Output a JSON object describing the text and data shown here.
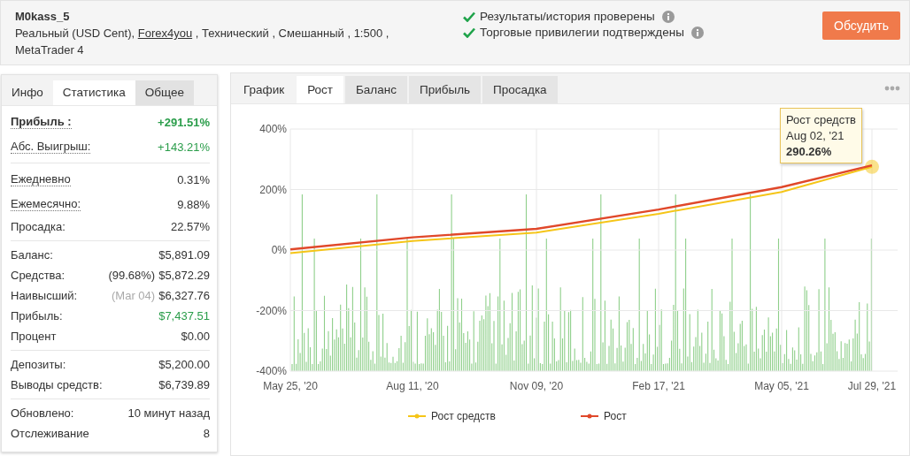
{
  "account": {
    "name": "M0kass_5",
    "details_before": "Реальный (USD Cent), ",
    "broker_link": "Forex4you",
    "details_after": " , Технический , Смешанный , 1:500 , MetaTrader 4"
  },
  "verifications": [
    {
      "text": "Результаты/история проверены",
      "verified": true
    },
    {
      "text": "Торговые привилегии подтверждены",
      "verified": true
    }
  ],
  "discuss_button": "Обсудить",
  "left_tabs": [
    {
      "label": "Инфо",
      "selected": false
    },
    {
      "label": "Статистика",
      "selected": true
    },
    {
      "label": "Общее",
      "selected": false
    }
  ],
  "stats_groups": [
    [
      {
        "label": "Прибыль :",
        "value": "+291.51%",
        "bold": true,
        "dotted": true,
        "positive": true
      },
      {
        "label": "Абс. Выигрыш:",
        "value": "+143.21%",
        "bold": false,
        "dotted": true,
        "positive": true
      }
    ],
    [
      {
        "label": "Ежедневно",
        "value": "0.31%",
        "bold": false,
        "dotted": true,
        "positive": false
      },
      {
        "label": "Ежемесячно:",
        "value": "9.88%",
        "bold": false,
        "dotted": true,
        "positive": false
      },
      {
        "label": "Просадка:",
        "value": "22.57%",
        "bold": false,
        "dotted": false,
        "positive": false
      }
    ],
    [
      {
        "label": "Баланс:",
        "value": "$5,891.09",
        "bold": false,
        "dotted": false,
        "positive": false
      },
      {
        "label": "Средства:",
        "note": "(99.68%)",
        "note_muted": false,
        "value": "$5,872.29",
        "bold": false,
        "dotted": false,
        "positive": false
      },
      {
        "label": "Наивысший:",
        "note": "(Mar 04)",
        "note_muted": true,
        "value": "$6,327.76",
        "bold": false,
        "dotted": false,
        "positive": false
      },
      {
        "label": "Прибыль:",
        "value": "$7,437.51",
        "bold": false,
        "dotted": false,
        "positive": true
      },
      {
        "label": "Процент",
        "value": "$0.00",
        "bold": false,
        "dotted": false,
        "positive": false
      }
    ],
    [
      {
        "label": "Депозиты:",
        "value": "$5,200.00",
        "bold": false,
        "dotted": false,
        "positive": false
      },
      {
        "label": "Выводы средств:",
        "value": "$6,739.89",
        "bold": false,
        "dotted": false,
        "positive": false
      }
    ],
    [
      {
        "label": "Обновлено:",
        "value": "10 минут назад",
        "bold": false,
        "dotted": false,
        "positive": false
      },
      {
        "label": "Отслеживание",
        "value": "8",
        "bold": false,
        "dotted": false,
        "positive": false
      }
    ]
  ],
  "chart_tabs": [
    {
      "label": "График",
      "selected": false
    },
    {
      "label": "Рост",
      "selected": true
    },
    {
      "label": "Баланс",
      "selected": false
    },
    {
      "label": "Прибыль",
      "selected": false
    },
    {
      "label": "Просадка",
      "selected": false
    }
  ],
  "chart": {
    "chart_data": {
      "type": "line",
      "categories": [
        "May 25, '20",
        "Aug 11, '20",
        "Nov 09, '20",
        "Feb 17, '21",
        "May 05, '21",
        "Jul 29, '21"
      ],
      "series": [
        {
          "name": "Рост средств",
          "color": "#f5c518",
          "values": [
            -10,
            30,
            58,
            120,
            192,
            275
          ]
        },
        {
          "name": "Рост",
          "color": "#e0482a",
          "values": [
            2,
            42,
            70,
            134,
            208,
            280
          ]
        }
      ],
      "grid": true,
      "legend": true,
      "ylim": [
        -400,
        400
      ],
      "yticks": [
        {
          "value": 400,
          "label": "400%"
        },
        {
          "value": 200,
          "label": "200%"
        },
        {
          "value": 0,
          "label": "0%"
        },
        {
          "value": -200,
          "label": "-200%"
        },
        {
          "value": -400,
          "label": "-400%"
        }
      ]
    },
    "tooltip": {
      "title": "Рост средств",
      "date": "Aug 02, '21",
      "value": "290.26%"
    }
  }
}
